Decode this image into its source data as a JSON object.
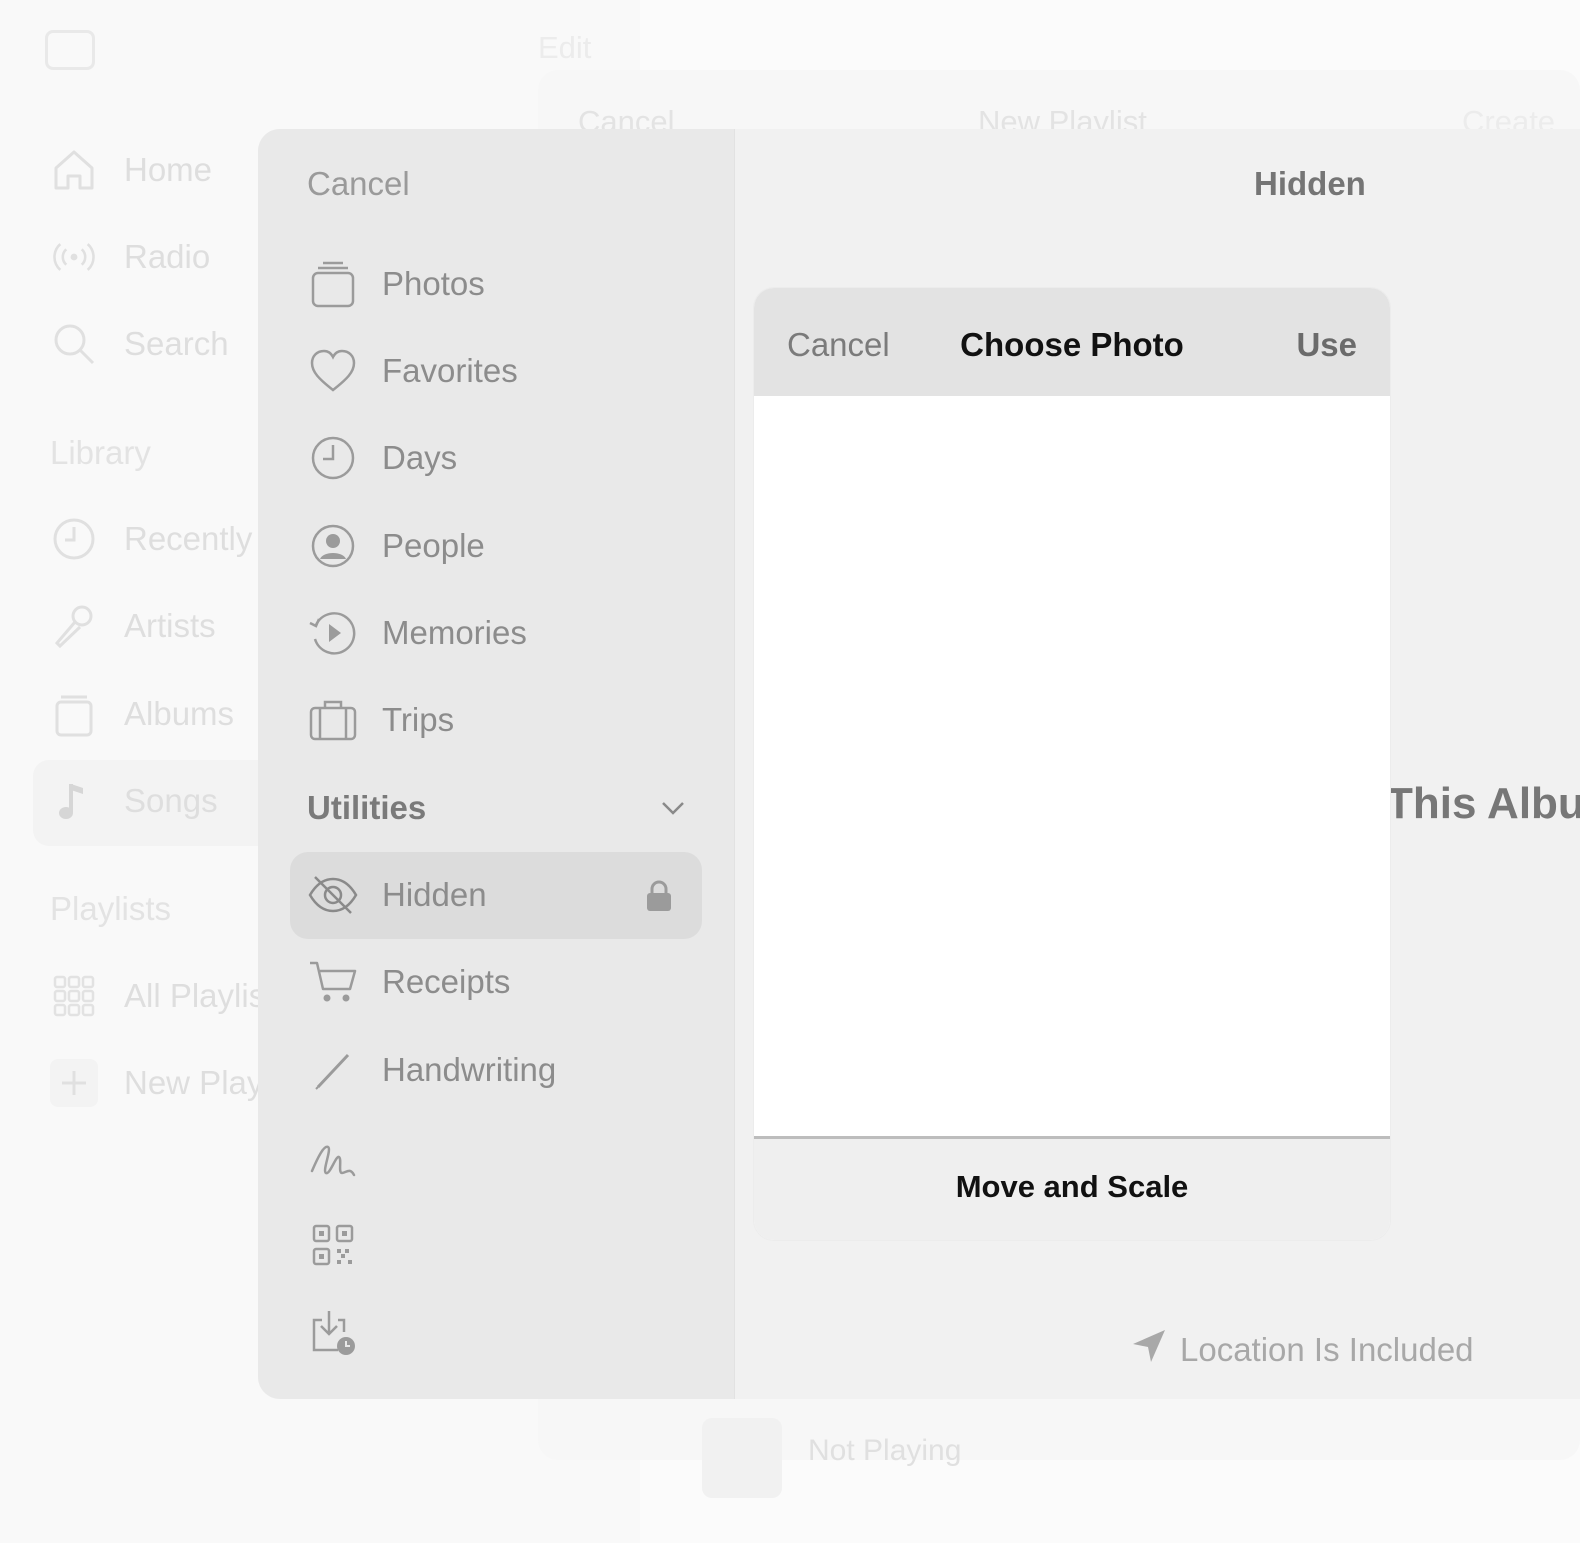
{
  "background_app": {
    "edit_label": "Edit",
    "nav": [
      {
        "label": "Home",
        "icon": "house-icon"
      },
      {
        "label": "Radio",
        "icon": "radio-waves-icon"
      },
      {
        "label": "Search",
        "icon": "search-icon"
      }
    ],
    "library_heading": "Library",
    "library": [
      {
        "label": "Recently",
        "icon": "clock-icon"
      },
      {
        "label": "Artists",
        "icon": "microphone-icon"
      },
      {
        "label": "Albums",
        "icon": "album-stack-icon"
      },
      {
        "label": "Songs",
        "icon": "music-note-icon"
      }
    ],
    "playlists_heading": "Playlists",
    "playlists": [
      {
        "label": "All Playlis",
        "icon": "grid-icon"
      },
      {
        "label": "New Play",
        "icon": "plus-icon"
      }
    ],
    "new_playlist_sheet": {
      "cancel_label": "Cancel",
      "title": "New Playlist",
      "create_label": "Create",
      "now_playing": "Not Playing"
    }
  },
  "picker": {
    "sidebar": {
      "cancel_label": "Cancel",
      "items": [
        {
          "label": "Photos",
          "icon": "photos-stack-icon"
        },
        {
          "label": "Favorites",
          "icon": "heart-icon"
        },
        {
          "label": "Days",
          "icon": "clock-icon"
        },
        {
          "label": "People",
          "icon": "person-circle-icon"
        },
        {
          "label": "Memories",
          "icon": "memories-play-icon"
        },
        {
          "label": "Trips",
          "icon": "suitcase-icon"
        }
      ],
      "utilities_label": "Utilities",
      "utilities": [
        {
          "label": "Hidden",
          "icon": "eye-slash-icon",
          "selected": true,
          "locked": true
        },
        {
          "label": "Receipts",
          "icon": "cart-icon"
        },
        {
          "label": "Handwriting",
          "icon": "pencil-icon"
        }
      ],
      "extra_icons": [
        "signature-icon",
        "qr-code-icon",
        "download-clock-icon"
      ]
    },
    "main": {
      "title": "Hidden",
      "album_text": "This Album",
      "location_label": "Location Is Included"
    },
    "dialog": {
      "cancel_label": "Cancel",
      "title": "Choose Photo",
      "use_label": "Use",
      "footer_label": "Move and Scale"
    }
  }
}
